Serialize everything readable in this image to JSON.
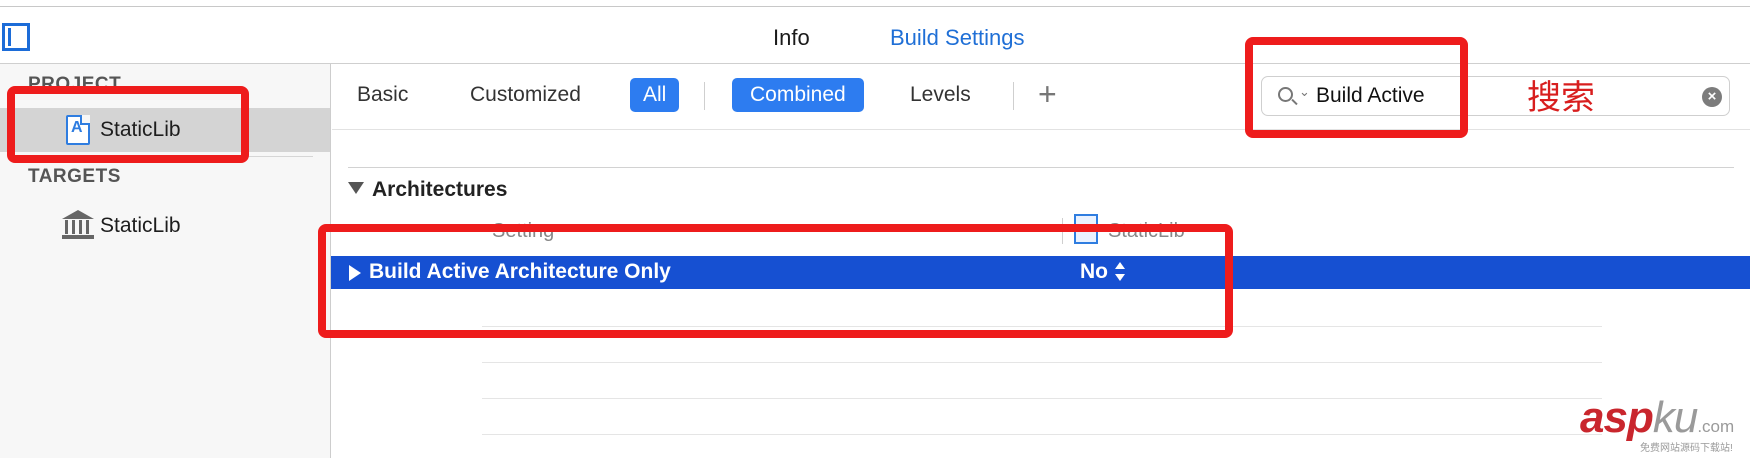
{
  "tabs": {
    "info": "Info",
    "build_settings": "Build Settings"
  },
  "navigator": {
    "project_header": "PROJECT",
    "project_item": "StaticLib",
    "targets_header": "TARGETS",
    "target_item": "StaticLib"
  },
  "filter": {
    "basic": "Basic",
    "customized": "Customized",
    "all": "All",
    "combined": "Combined",
    "levels": "Levels",
    "add": "+"
  },
  "search": {
    "value": "Build Active",
    "clear": "×"
  },
  "annotation": {
    "label": "搜索",
    "color": "#ee1c1c"
  },
  "table": {
    "section": "Architectures",
    "col_setting": "Setting",
    "col_target": "StaticLib",
    "row": {
      "name": "Build Active Architecture Only",
      "value": "No"
    }
  },
  "watermark": {
    "brand": "asp",
    "brand_suffix": "ku",
    "domain": ".com",
    "tagline": "免费网站源码下载站!"
  },
  "colors": {
    "accent": "#2d7cf0",
    "selection": "#1650d2",
    "annotation": "#ee1c1c"
  },
  "icons": [
    "sidebar-toggle-icon",
    "project-file-icon",
    "target-building-icon",
    "search-icon",
    "clear-icon",
    "disclosure-triangle-icon",
    "stepper-icon"
  ]
}
